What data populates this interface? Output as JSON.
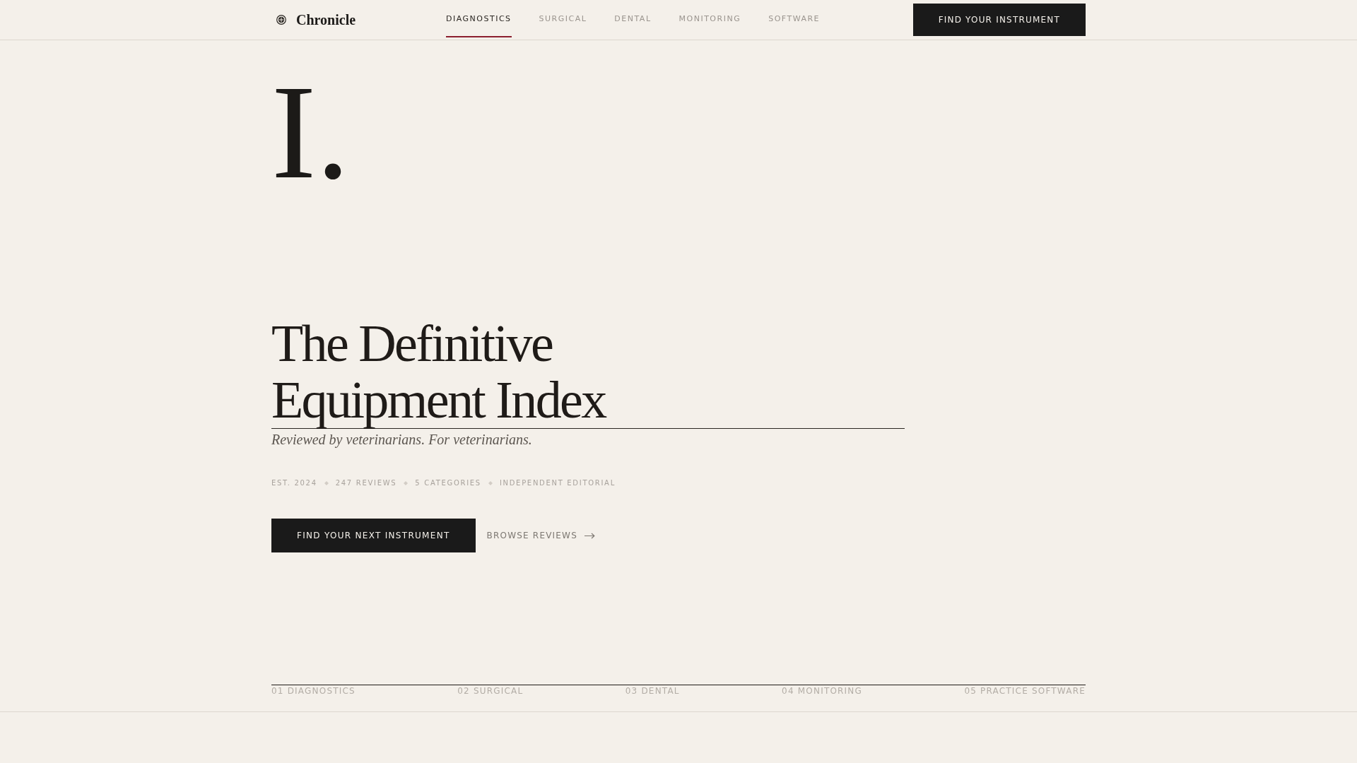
{
  "header": {
    "logo": "Chronicle",
    "nav": [
      {
        "label": "DIAGNOSTICS",
        "selected": true
      },
      {
        "label": "SURGICAL",
        "selected": false
      },
      {
        "label": "DENTAL",
        "selected": false
      },
      {
        "label": "MONITORING",
        "selected": false
      },
      {
        "label": "SOFTWARE",
        "selected": false
      }
    ],
    "cta": "FIND YOUR INSTRUMENT"
  },
  "hero": {
    "numeral": "I.",
    "title": "The Definitive Equipment Index",
    "subtitle": "Reviewed by veterinarians. For veterinarians.",
    "meta": [
      "EST. 2024",
      "247 REVIEWS",
      "5 CATEGORIES",
      "INDEPENDENT EDITORIAL"
    ],
    "primary_button": "FIND YOUR NEXT INSTRUMENT",
    "secondary_link": "BROWSE REVIEWS"
  },
  "category_index": [
    "01 DIAGNOSTICS",
    "02 SURGICAL",
    "03 DENTAL",
    "04 MONITORING",
    "05 PRACTICE SOFTWARE"
  ]
}
